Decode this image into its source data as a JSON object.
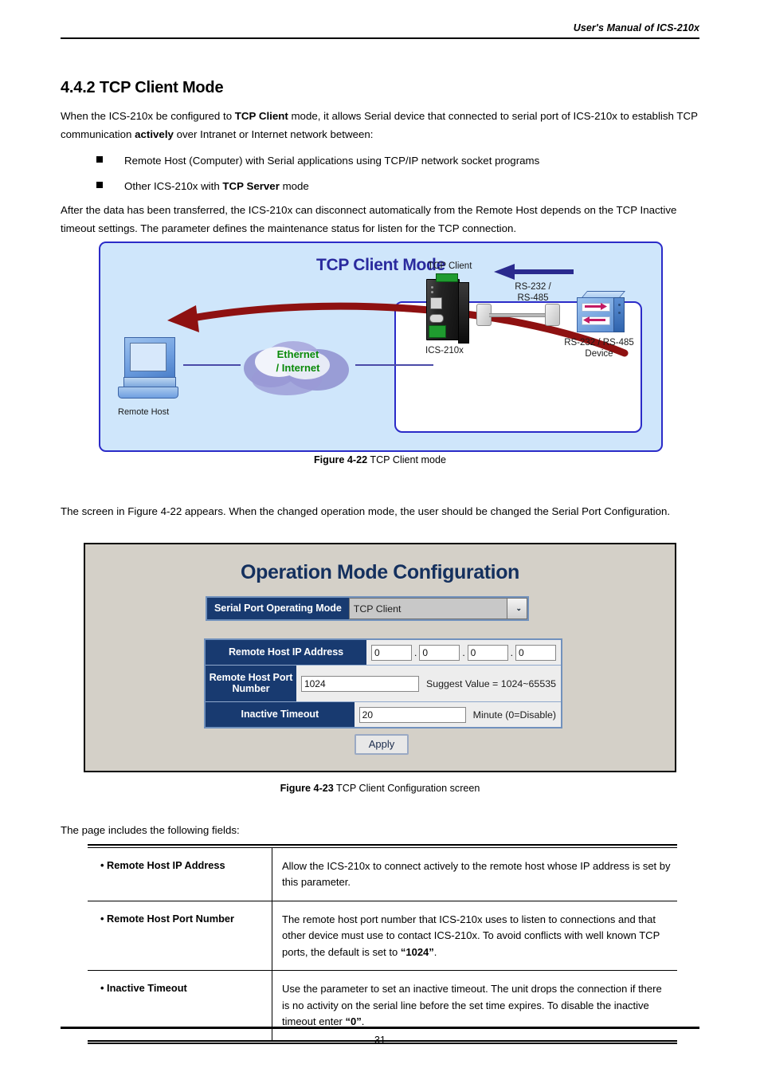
{
  "header": {
    "manual_title": "User's Manual of ICS-210x"
  },
  "section": {
    "heading": "4.4.2 TCP Client Mode",
    "intro_p1_part1": "When the ICS-210x be configured to ",
    "intro_p1_bold1": "TCP Client",
    "intro_p1_part2": " mode, it allows Serial device that connected to serial port of ICS-210x to establish TCP communication ",
    "intro_p1_bold2": "actively",
    "intro_p1_part3": " over Intranet or Internet network between:",
    "bullet1": "Remote Host (Computer) with Serial applications using TCP/IP network socket programs",
    "bullet2_part1": "Other ICS-210x with ",
    "bullet2_bold": "TCP Server",
    "bullet2_part2": " mode",
    "intro_p2": "After the data has been transferred, the ICS-210x can disconnect automatically from the Remote Host depends on the TCP Inactive timeout settings. The parameter defines the maintenance status for listen for the TCP connection.",
    "screen_para": "The screen in Figure 4-22 appears. When the changed operation mode, the user should be changed the Serial Port Configuration.",
    "fields_intro": "The page includes the following fields:"
  },
  "figure1": {
    "title": "TCP Client Mode",
    "remote_host_label": "Remote Host",
    "cloud_line1": "Ethernet",
    "cloud_line2": "/ Internet",
    "tcp_client_label": "TCP Client",
    "device_label": "ICS-210x",
    "serial_line1": "RS-232 /",
    "serial_line2": "RS-485",
    "rs_device_line1": "RS-232 / RS-485",
    "rs_device_line2": "Device",
    "caption_bold": "Figure 4-22",
    "caption_text": " TCP Client mode",
    "colors": {
      "panel_bg": "#cfe6fb",
      "panel_border": "#2b2bc8",
      "title_color": "#2a2a9e",
      "cloud_text": "#0a8a0a",
      "wan_arrow": "#8e1111",
      "serial_arrow": "#2a2a8e"
    }
  },
  "figure2": {
    "title": "Operation Mode Configuration",
    "mode_label": "Serial Port Operating Mode",
    "mode_value": "TCP Client",
    "mode_caret": "⌄",
    "rows": [
      {
        "label": "Remote Host IP Address",
        "octets": [
          "0",
          "0",
          "0",
          "0"
        ],
        "hint": ""
      },
      {
        "label": "Remote Host Port Number",
        "value": "1024",
        "hint": "Suggest Value = 1024~65535"
      },
      {
        "label": "Inactive Timeout",
        "value": "20",
        "hint": "Minute (0=Disable)"
      }
    ],
    "apply_label": "Apply",
    "caption_bold": "Figure 4-23",
    "caption_text": " TCP Client Configuration screen",
    "colors": {
      "page_bg": "#d4d0c8",
      "label_bg": "#183a70",
      "title_color": "#14305e",
      "field_bg": "#ededed",
      "table_border": "#7191bd"
    }
  },
  "fields_table": {
    "rows": [
      {
        "name": "• Remote Host IP Address",
        "desc": "Allow the ICS-210x to connect actively to the remote host whose IP address is set by this parameter.",
        "desc_tail": ""
      },
      {
        "name": "• Remote Host  Port Number",
        "desc": "The remote host port number that ICS-210x uses to listen to connections and that other device must use to contact ICS-210x. To avoid conflicts with well known TCP ports, the default is set to ",
        "desc_bold": "“1024”",
        "desc_tail": "."
      },
      {
        "name": "• Inactive Timeout",
        "desc": "Use the parameter to set an inactive timeout. The unit drops the connection if there is no activity on the serial line before the set time expires. To disable the inactive timeout enter ",
        "desc_bold": "“0”",
        "desc_tail": "."
      }
    ]
  },
  "footer": {
    "page_number": "-31-"
  }
}
